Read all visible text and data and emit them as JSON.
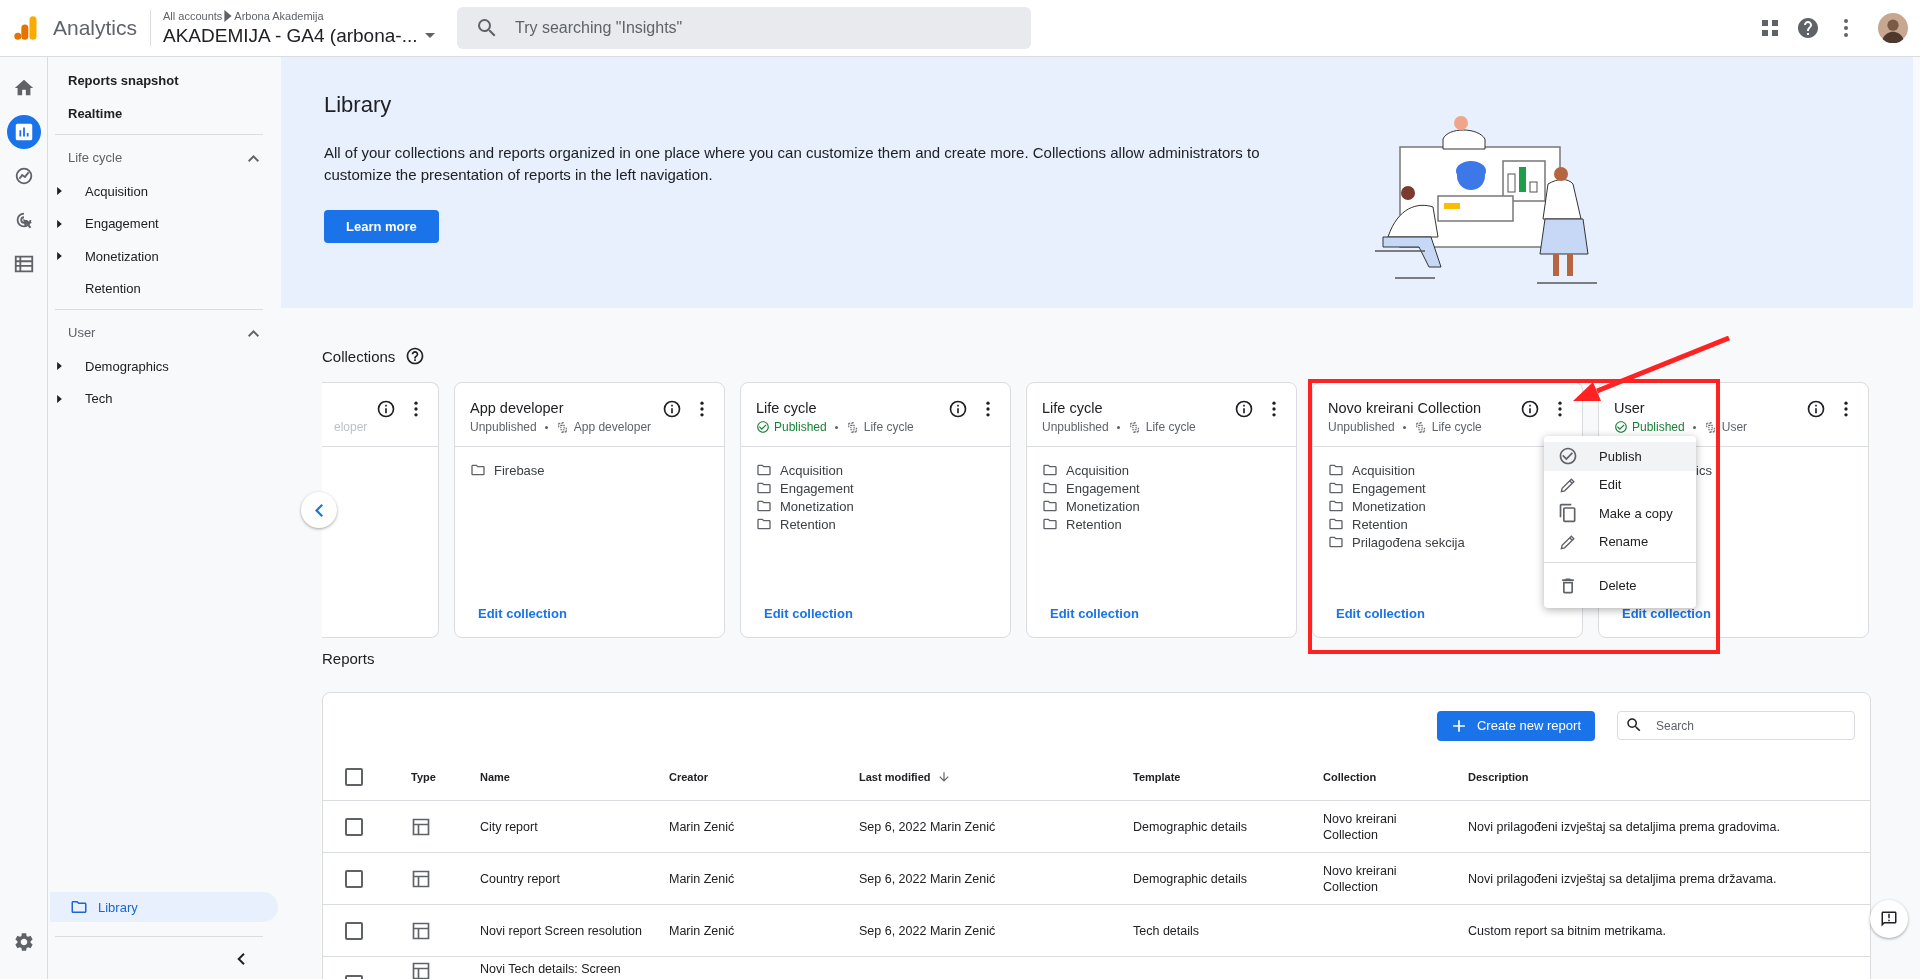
{
  "topbar": {
    "product": "Analytics",
    "breadcrumb": [
      "All accounts",
      "Arbona Akademija"
    ],
    "property": "AKADEMIJA - GA4 (arbona-...",
    "search": {
      "placeholder": "Try searching \"Insights\""
    }
  },
  "rail": [
    {
      "kind": "home",
      "selected": false
    },
    {
      "kind": "reports",
      "selected": true
    },
    {
      "kind": "explore",
      "selected": false
    },
    {
      "kind": "advertising",
      "selected": false
    },
    {
      "kind": "configure",
      "selected": false
    }
  ],
  "nav": {
    "top_items": [
      "Reports snapshot",
      "Realtime"
    ],
    "sections": [
      {
        "title": "Life cycle",
        "expanded": true,
        "items": [
          {
            "label": "Acquisition",
            "expandable": true
          },
          {
            "label": "Engagement",
            "expandable": true
          },
          {
            "label": "Monetization",
            "expandable": true
          },
          {
            "label": "Retention",
            "expandable": false
          }
        ]
      },
      {
        "title": "User",
        "expanded": true,
        "items": [
          {
            "label": "Demographics",
            "expandable": true
          },
          {
            "label": "Tech",
            "expandable": true
          }
        ]
      }
    ],
    "library": {
      "label": "Library",
      "selected": true
    }
  },
  "banner": {
    "title": "Library",
    "description": "All of your collections and reports organized in one place where you can customize them and create more. Collections allow administrators to customize the presentation of reports in the left navigation.",
    "button": "Learn more"
  },
  "collections": {
    "title": "Collections",
    "cards": [
      {
        "kind": "partial",
        "source": "eloper"
      },
      {
        "kind": "full",
        "title": "App developer",
        "status": "Unpublished",
        "published": false,
        "source": "App developer",
        "items": [
          {
            "label": "Firebase"
          }
        ],
        "link": "Edit collection"
      },
      {
        "kind": "full",
        "title": "Life cycle",
        "status": "Published",
        "published": true,
        "source": "Life cycle",
        "items": [
          {
            "label": "Acquisition"
          },
          {
            "label": "Engagement"
          },
          {
            "label": "Monetization"
          },
          {
            "label": "Retention"
          }
        ],
        "link": "Edit collection"
      },
      {
        "kind": "full",
        "title": "Life cycle",
        "status": "Unpublished",
        "published": false,
        "source": "Life cycle",
        "items": [
          {
            "label": "Acquisition"
          },
          {
            "label": "Engagement"
          },
          {
            "label": "Monetization"
          },
          {
            "label": "Retention"
          }
        ],
        "link": "Edit collection"
      },
      {
        "kind": "full",
        "title": "Novo kreirani Collection",
        "status": "Unpublished",
        "published": false,
        "source": "Life cycle",
        "items": [
          {
            "label": "Acquisition"
          },
          {
            "label": "Engagement"
          },
          {
            "label": "Monetization"
          },
          {
            "label": "Retention"
          },
          {
            "label": "Prilagođena sekcija"
          }
        ],
        "link": "Edit collection"
      },
      {
        "kind": "full",
        "title": "User",
        "status": "Published",
        "published": true,
        "source": "User",
        "items": [
          {
            "label": "ics",
            "covered": true
          }
        ],
        "link": "Edit collection"
      }
    ]
  },
  "menu": {
    "items": [
      {
        "label": "Publish",
        "kind": "check",
        "highlighted": true,
        "divider_before": false
      },
      {
        "label": "Edit",
        "kind": "pencil",
        "highlighted": false,
        "divider_before": false
      },
      {
        "label": "Make a copy",
        "kind": "copy",
        "highlighted": false,
        "divider_before": false
      },
      {
        "label": "Rename",
        "kind": "pencil",
        "highlighted": false,
        "divider_before": false
      },
      {
        "label": "Delete",
        "kind": "trash",
        "highlighted": false,
        "divider_before": true
      }
    ]
  },
  "reports": {
    "title": "Reports",
    "create_button": "Create new report",
    "search": {
      "placeholder": "Search"
    },
    "all_checked": false,
    "columns": [
      {
        "label": "Type",
        "sorted": false
      },
      {
        "label": "Name",
        "sorted": false
      },
      {
        "label": "Creator",
        "sorted": false
      },
      {
        "label": "Last modified",
        "sorted": true
      },
      {
        "label": "Template",
        "sorted": false
      },
      {
        "label": "Collection",
        "sorted": false
      },
      {
        "label": "Description",
        "sorted": false
      }
    ],
    "rows": [
      {
        "checked": false,
        "cells": [
          "",
          "City report",
          "Marin Zenić",
          "Sep 6, 2022 Marin Zenić",
          "Demographic details",
          "Novo kreirani Collection",
          "Novi prilagođeni izvještaj sa detaljima prema gradovima."
        ]
      },
      {
        "checked": false,
        "cells": [
          "",
          "Country report",
          "Marin Zenić",
          "Sep 6, 2022 Marin Zenić",
          "Demographic details",
          "Novo kreirani Collection",
          "Novi prilagođeni izvještaj sa detaljima prema državama."
        ]
      },
      {
        "checked": false,
        "cells": [
          "",
          "Novi report Screen resolution",
          "Marin Zenić",
          "Sep 6, 2022 Marin Zenić",
          "Tech details",
          "",
          "Custom report sa bitnim metrikama."
        ]
      },
      {
        "checked": false,
        "kind": "partial",
        "cells": [
          "",
          "Novi Tech details: Screen"
        ]
      }
    ]
  }
}
